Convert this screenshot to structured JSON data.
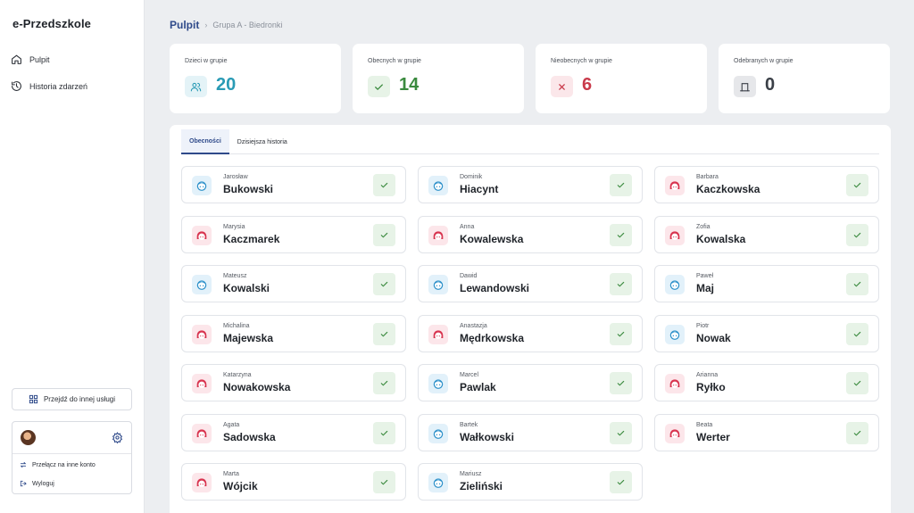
{
  "sidebar": {
    "brand": "e-Przedszkole",
    "nav": [
      {
        "label": "Pulpit",
        "icon": "home-icon"
      },
      {
        "label": "Historia zdarzeń",
        "icon": "history-icon"
      }
    ],
    "switch_service_label": "Przejdź do innej usługi",
    "account": {
      "switch_account_label": "Przełącz na inne konto",
      "logout_label": "Wyloguj"
    }
  },
  "breadcrumb": {
    "root": "Pulpit",
    "separator": ">",
    "current": "Grupa A - Biedronki"
  },
  "stats": [
    {
      "label": "Dzieci w grupie",
      "value": "20",
      "icon": "users-icon",
      "color": "#2a9bb5",
      "bg": "#e4f3f7"
    },
    {
      "label": "Obecnych w grupie",
      "value": "14",
      "icon": "check-icon",
      "color": "#3a8a3e",
      "bg": "#e7f3e7"
    },
    {
      "label": "Nieobecnych w grupie",
      "value": "6",
      "icon": "x-icon",
      "color": "#c93a4a",
      "bg": "#fbe7ea"
    },
    {
      "label": "Odebranych w grupie",
      "value": "0",
      "icon": "door-icon",
      "color": "#3a3f47",
      "bg": "#e6e7ea"
    }
  ],
  "tabs": [
    {
      "label": "Obecności",
      "active": true
    },
    {
      "label": "Dzisiejsza historia",
      "active": false
    }
  ],
  "children": [
    {
      "first": "Jarosław",
      "last": "Bukowski",
      "gender": "boy"
    },
    {
      "first": "Dominik",
      "last": "Hiacynt",
      "gender": "boy"
    },
    {
      "first": "Barbara",
      "last": "Kaczkowska",
      "gender": "girl"
    },
    {
      "first": "Marysia",
      "last": "Kaczmarek",
      "gender": "girl"
    },
    {
      "first": "Anna",
      "last": "Kowalewska",
      "gender": "girl"
    },
    {
      "first": "Zofia",
      "last": "Kowalska",
      "gender": "girl"
    },
    {
      "first": "Mateusz",
      "last": "Kowalski",
      "gender": "boy"
    },
    {
      "first": "Dawid",
      "last": "Lewandowski",
      "gender": "boy"
    },
    {
      "first": "Paweł",
      "last": "Maj",
      "gender": "boy"
    },
    {
      "first": "Michalina",
      "last": "Majewska",
      "gender": "girl"
    },
    {
      "first": "Anastazja",
      "last": "Mędrkowska",
      "gender": "girl"
    },
    {
      "first": "Piotr",
      "last": "Nowak",
      "gender": "boy"
    },
    {
      "first": "Katarzyna",
      "last": "Nowakowska",
      "gender": "girl"
    },
    {
      "first": "Marcel",
      "last": "Pawlak",
      "gender": "boy"
    },
    {
      "first": "Arianna",
      "last": "Ryłko",
      "gender": "girl"
    },
    {
      "first": "Agata",
      "last": "Sadowska",
      "gender": "girl"
    },
    {
      "first": "Bartek",
      "last": "Wałkowski",
      "gender": "boy"
    },
    {
      "first": "Beata",
      "last": "Werter",
      "gender": "girl"
    },
    {
      "first": "Marta",
      "last": "Wójcik",
      "gender": "girl"
    },
    {
      "first": "Mariusz",
      "last": "Zieliński",
      "gender": "boy"
    }
  ],
  "colors": {
    "accent": "#2f4a8a",
    "boy_avatar_bg": "#e2f1fa",
    "boy_avatar": "#2a8fc9",
    "girl_avatar_bg": "#fce6ea",
    "girl_avatar": "#d8344f",
    "present_check": "#3a8a3e"
  }
}
